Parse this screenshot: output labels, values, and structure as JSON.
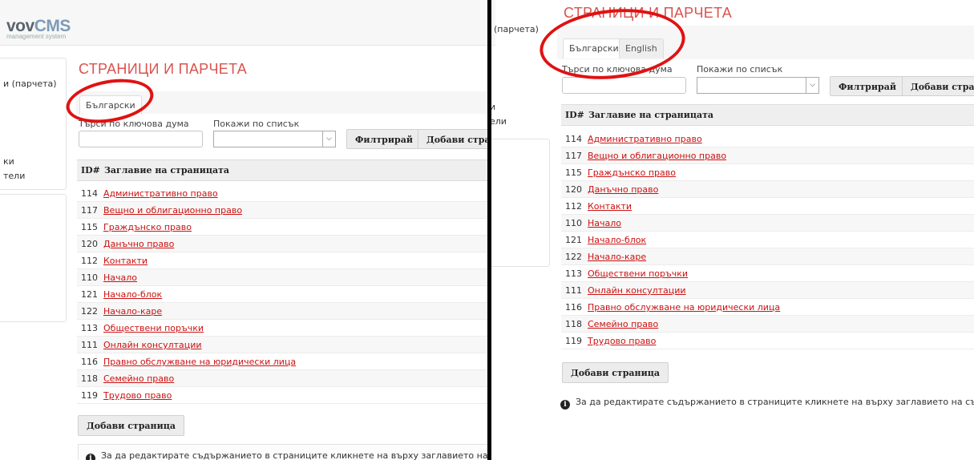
{
  "logo": {
    "brand": "vov",
    "brand_accent": "CMS",
    "tagline": "management system"
  },
  "left_sidebar_items": [
    "и (парчета)",
    "ки",
    "тели"
  ],
  "right_sidebar_items": [
    "(парчета)",
    "и",
    "ели"
  ],
  "page_title": "СТРАНИЦИ И ПАРЧЕТА",
  "tabs": {
    "bulgarian": "Български",
    "english": "English"
  },
  "filter": {
    "keyword_label": "Търси по ключова дума",
    "list_label": "Покажи по списък",
    "filter_button": "Филтрирай",
    "add_page_button": "Добави страница"
  },
  "table": {
    "columns": [
      "ID#",
      "Заглавие на страницата"
    ],
    "rows": [
      {
        "id": "114",
        "title": "Административно право"
      },
      {
        "id": "117",
        "title": "Вещно и облигационно право"
      },
      {
        "id": "115",
        "title": "Граждънско право"
      },
      {
        "id": "120",
        "title": "Данъчно право"
      },
      {
        "id": "112",
        "title": "Контакти"
      },
      {
        "id": "110",
        "title": "Начало"
      },
      {
        "id": "121",
        "title": "Начало-блок"
      },
      {
        "id": "122",
        "title": "Начало-каре"
      },
      {
        "id": "113",
        "title": "Обществени поръчки"
      },
      {
        "id": "111",
        "title": "Онлайн консултации"
      },
      {
        "id": "116",
        "title": "Правно обслужване на юридически лица"
      },
      {
        "id": "118",
        "title": "Семейно право"
      },
      {
        "id": "119",
        "title": "Трудово право"
      }
    ]
  },
  "add_page_bottom": "Добави страница",
  "info_text": "За да редактирате съдържанието в страниците кликнете на върху заглавието на съответната страница."
}
